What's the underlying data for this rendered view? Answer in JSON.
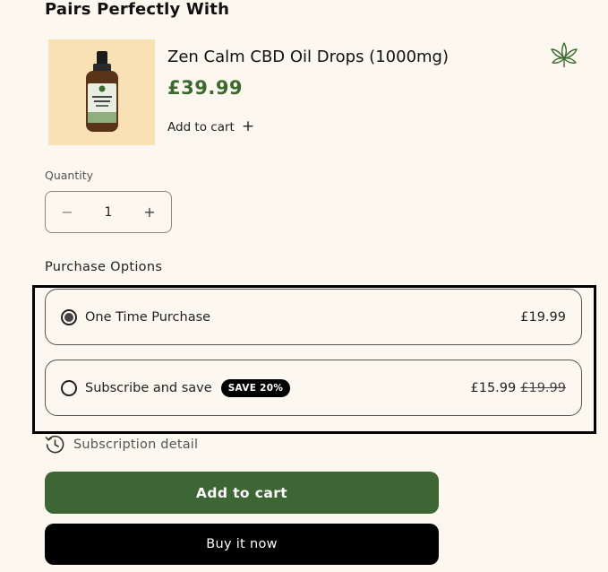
{
  "section": {
    "heading": "Pairs Perfectly With"
  },
  "pairing": {
    "product_title": "Zen Calm CBD Oil Drops (1000mg)",
    "price": "£39.99",
    "add_label": "Add to cart",
    "add_icon": "+",
    "image_icon": "cbd-oil-bottle-icon",
    "badge_icon": "hemp-leaf-icon",
    "image_bg": "#fae1b5",
    "price_color": "#3b6a2f"
  },
  "quantity": {
    "label": "Quantity",
    "value": "1",
    "minus": "−",
    "plus": "+"
  },
  "purchase_options": {
    "label": "Purchase Options",
    "options": [
      {
        "label": "One Time Purchase",
        "price": "£19.99",
        "selected": true
      },
      {
        "label": "Subscribe and save",
        "badge": "SAVE 20%",
        "price": "£15.99",
        "old_price": "£19.99",
        "selected": false
      }
    ]
  },
  "subscription": {
    "detail_label": "Subscription detail",
    "icon": "history-clock-icon"
  },
  "actions": {
    "add_to_cart": "Add to cart",
    "buy_now": "Buy it now",
    "cart_color": "#3d6634",
    "buy_color": "#000000"
  }
}
